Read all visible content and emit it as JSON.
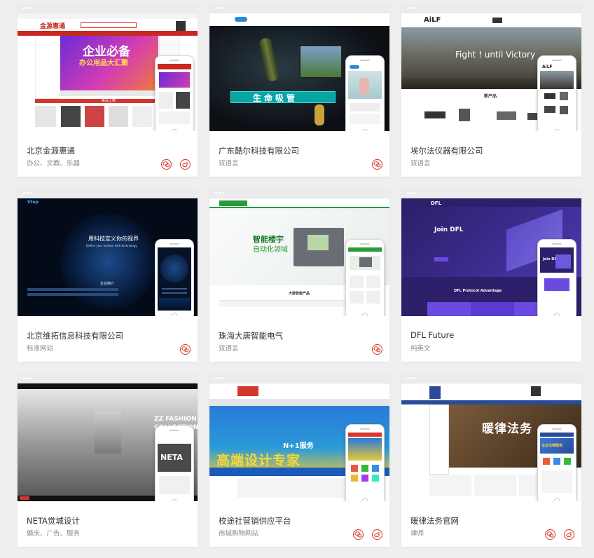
{
  "colors": {
    "accent": "#d4382c",
    "title": "#333333",
    "subtitle": "#888888",
    "background": "#efefef"
  },
  "icons": {
    "primary": "wechat-icon",
    "secondary": "weibo-icon"
  },
  "cards": [
    {
      "title": "北京金源惠通",
      "subtitle": "办公、文教、乐器",
      "actions": [
        "wechat-icon",
        "weibo-icon"
      ],
      "shot": {
        "logo": "金源惠通",
        "banner": "企业必备",
        "banner_sub": "办公用品大汇聚",
        "section": "新品上架"
      }
    },
    {
      "title": "广东酷尔科技有限公司",
      "subtitle": "双语言",
      "actions": [
        "wechat-icon"
      ],
      "shot": {
        "banner": "生命吸管"
      }
    },
    {
      "title": "埃尔法仪器有限公司",
      "subtitle": "双语言",
      "actions": [],
      "shot": {
        "logo": "AiLF",
        "slogan": "Fight ! until Victory",
        "section": "新产品",
        "phone_logo": "AiLF"
      }
    },
    {
      "title": "北京维拓信息科技有限公司",
      "subtitle": "标准网站",
      "actions": [
        "wechat-icon"
      ],
      "shot": {
        "logo": "Vtop",
        "slogan": "用科技定义你的视界",
        "slogan_en": "Define your horizon with technology",
        "section": "企业简介"
      }
    },
    {
      "title": "珠海大唐智能电气",
      "subtitle": "双语言",
      "actions": [
        "wechat-icon"
      ],
      "shot": {
        "banner": "智能楼宇",
        "banner_sub": "自动化领域",
        "section": "大唐智能产品"
      }
    },
    {
      "title": "DFL Future",
      "subtitle": "纯英文",
      "actions": [],
      "shot": {
        "logo": "DFL",
        "slogan": "Join DFL",
        "section": "DFL Protocol Advantage",
        "phone_slogan": "Join DFL"
      }
    },
    {
      "title": "NETA觉城设计",
      "subtitle": "婚庆、广告、服务",
      "actions": [],
      "shot": {
        "banner": "ZZ FASHION COLLECTION SHOW",
        "phone_banner": "NETA"
      }
    },
    {
      "title": "校途社营销供应平台",
      "subtitle": "商城购物网站",
      "actions": [
        "wechat-icon",
        "weibo-icon"
      ],
      "shot": {
        "banner": "N+1服务",
        "banner_main": "高端设计专家"
      }
    },
    {
      "title": "暖律法务官网",
      "subtitle": "律师",
      "actions": [
        "wechat-icon",
        "weibo-icon"
      ],
      "shot": {
        "banner": "暖律法务",
        "phone_banner": "企业法律服务"
      }
    }
  ]
}
